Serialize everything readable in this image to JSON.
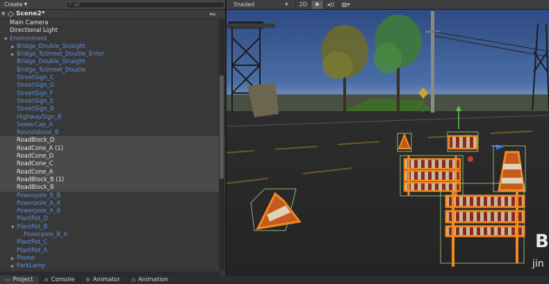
{
  "hierarchy": {
    "create_label": "Create",
    "search_placeholder": "All",
    "scene_title": "Scene2*",
    "items": [
      {
        "label": "Main Camera",
        "kind": "plain",
        "indent": "indent0b",
        "arrow": ""
      },
      {
        "label": "Directional Light",
        "kind": "plain",
        "indent": "indent0b",
        "arrow": ""
      },
      {
        "label": "Environment",
        "kind": "prefab",
        "indent": "indent0",
        "arrow": "▼"
      },
      {
        "label": "Bridge_Double_Straight",
        "kind": "prefab",
        "indent": "indent1",
        "arrow": "▶"
      },
      {
        "label": "Bridge_ToStreet_Double_Enter",
        "kind": "prefab",
        "indent": "indent1",
        "arrow": "▶"
      },
      {
        "label": "Bridge_Double_Straight",
        "kind": "prefab",
        "indent": "indent1b",
        "arrow": ""
      },
      {
        "label": "Bridge_ToStreet_Double",
        "kind": "prefab",
        "indent": "indent1b",
        "arrow": ""
      },
      {
        "label": "StreetSign_C",
        "kind": "prefab",
        "indent": "indent1b",
        "arrow": ""
      },
      {
        "label": "StreetSign_G",
        "kind": "prefab",
        "indent": "indent1b",
        "arrow": ""
      },
      {
        "label": "StreetSign_F",
        "kind": "prefab",
        "indent": "indent1b",
        "arrow": ""
      },
      {
        "label": "StreetSign_E",
        "kind": "prefab",
        "indent": "indent1b",
        "arrow": ""
      },
      {
        "label": "StreetSign_B",
        "kind": "prefab",
        "indent": "indent1b",
        "arrow": ""
      },
      {
        "label": "HighwaySign_B",
        "kind": "prefab",
        "indent": "indent1b",
        "arrow": ""
      },
      {
        "label": "SewerCap_A",
        "kind": "prefab",
        "indent": "indent1b",
        "arrow": ""
      },
      {
        "label": "Roundabout_B",
        "kind": "prefab",
        "indent": "indent1b",
        "arrow": ""
      },
      {
        "label": "RoadBlock_D",
        "kind": "plain",
        "indent": "indent1b",
        "arrow": "",
        "selected": true
      },
      {
        "label": "RoadCone_A (1)",
        "kind": "plain",
        "indent": "indent1b",
        "arrow": "",
        "selected": true
      },
      {
        "label": "RoadCone_D",
        "kind": "plain",
        "indent": "indent1b",
        "arrow": "",
        "selected": true
      },
      {
        "label": "RoadCone_C",
        "kind": "plain",
        "indent": "indent1b",
        "arrow": "",
        "selected": true
      },
      {
        "label": "RoadCone_A",
        "kind": "plain",
        "indent": "indent1b",
        "arrow": "",
        "selected": true
      },
      {
        "label": "RoadBlock_B (1)",
        "kind": "plain",
        "indent": "indent1b",
        "arrow": "",
        "selected": true
      },
      {
        "label": "RoadBlock_B",
        "kind": "plain",
        "indent": "indent1b",
        "arrow": "",
        "selected": true
      },
      {
        "label": "Powerpole_B_B",
        "kind": "prefab",
        "indent": "indent1b",
        "arrow": ""
      },
      {
        "label": "Powerpole_A_A",
        "kind": "prefab",
        "indent": "indent1b",
        "arrow": ""
      },
      {
        "label": "Powerpole_A_B",
        "kind": "prefab",
        "indent": "indent1b",
        "arrow": ""
      },
      {
        "label": "PlantPot_D",
        "kind": "prefab",
        "indent": "indent1b",
        "arrow": ""
      },
      {
        "label": "PlantPot_B",
        "kind": "prefab",
        "indent": "indent1",
        "arrow": "▼"
      },
      {
        "label": "Powerpole_B_A",
        "kind": "prefab",
        "indent": "indent2",
        "arrow": ""
      },
      {
        "label": "PlantPot_C",
        "kind": "prefab",
        "indent": "indent1b",
        "arrow": ""
      },
      {
        "label": "PlantPot_A",
        "kind": "prefab",
        "indent": "indent1b",
        "arrow": ""
      },
      {
        "label": "Phone",
        "kind": "prefab",
        "indent": "indent1",
        "arrow": "▶"
      },
      {
        "label": "ParkLamp",
        "kind": "prefab",
        "indent": "indent1",
        "arrow": "▶"
      }
    ]
  },
  "scene_view": {
    "shading_mode": "Shaded",
    "mode_2d_label": "2D",
    "watermark_text": "B",
    "watermark_sub": "jin",
    "colors": {
      "sky": "#3c5c96",
      "road": "#2b2b2b",
      "selection_outline": "#f28a22",
      "bounds": "#a5e08a"
    }
  },
  "bottom_tabs": [
    {
      "label": "Project",
      "icon": "folder-icon",
      "active": true
    },
    {
      "label": "Console",
      "icon": "console-icon",
      "active": false
    },
    {
      "label": "Animator",
      "icon": "animator-icon",
      "active": false
    },
    {
      "label": "Animation",
      "icon": "animation-icon",
      "active": false
    }
  ]
}
